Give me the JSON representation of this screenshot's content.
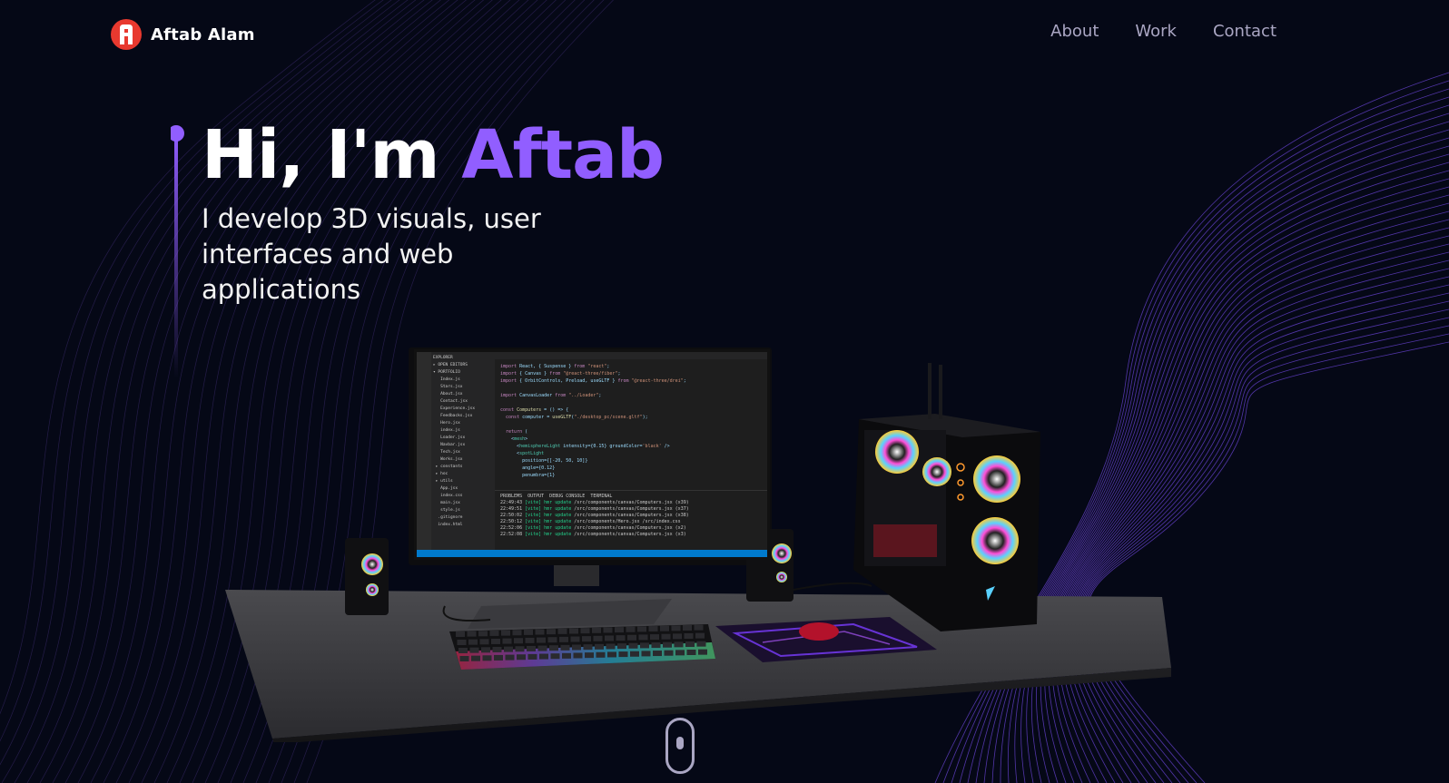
{
  "brand": {
    "logo_letter": "A",
    "name": "Aftab Alam"
  },
  "nav": {
    "items": [
      {
        "label": "About"
      },
      {
        "label": "Work"
      },
      {
        "label": "Contact"
      }
    ]
  },
  "hero": {
    "greeting": "Hi, I'm ",
    "name": "Aftab",
    "subtitle": "I develop 3D visuals, user interfaces and web applications"
  },
  "colors": {
    "background": "#050816",
    "accent": "#915eff",
    "logo_red": "#e8392f",
    "nav_text": "#aaa6c3"
  },
  "icons": {
    "logo": "letter-badge",
    "scroll": "mouse-scroll-icon"
  }
}
